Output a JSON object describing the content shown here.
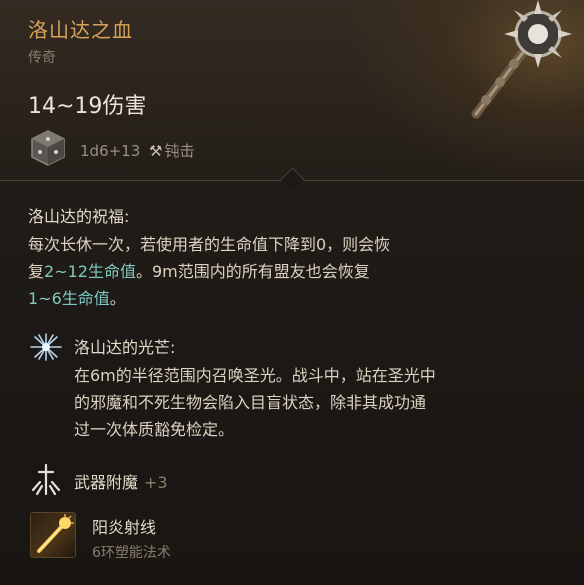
{
  "item": {
    "name": "洛山达之血",
    "rarity": "传奇",
    "damage": "14~19伤害",
    "dice_formula": "1d6+13",
    "damage_type": "钝击"
  },
  "blessing": {
    "title": "洛山达的祝福:",
    "line1": "每次长休一次，若使用者的生命值下降到0，则会恢",
    "line2_pre": "复",
    "line2_heal": "2~12生命值",
    "line2_post": "。9m范围内的所有盟友也会恢复",
    "line3_heal": "1~6生命值",
    "line3_post": "。"
  },
  "radiance": {
    "title": "洛山达的光芒:",
    "line1": "在6m的半径范围内召唤圣光。战斗中，站在圣光中",
    "line2": "的邪魔和不死生物会陷入目盲状态，除非其成功通",
    "line3": "过一次体质豁免检定。"
  },
  "enchant": {
    "title": "武器附魔",
    "bonus": "+3"
  },
  "spell": {
    "name": "阳炎射线",
    "level": "6环塑能法术"
  },
  "colors": {
    "title": "#d8a25a",
    "heal": "#7fc9c0",
    "muted": "#8a7c6c",
    "body": "#ddd2c2"
  },
  "icons": {
    "dice": "dice-icon",
    "damage_type": "hammer-icon",
    "radiance": "radiance-icon",
    "enchant": "enchant-sword-icon",
    "spell": "sunbeam-spell-icon",
    "weapon": "mace-weapon-icon"
  }
}
